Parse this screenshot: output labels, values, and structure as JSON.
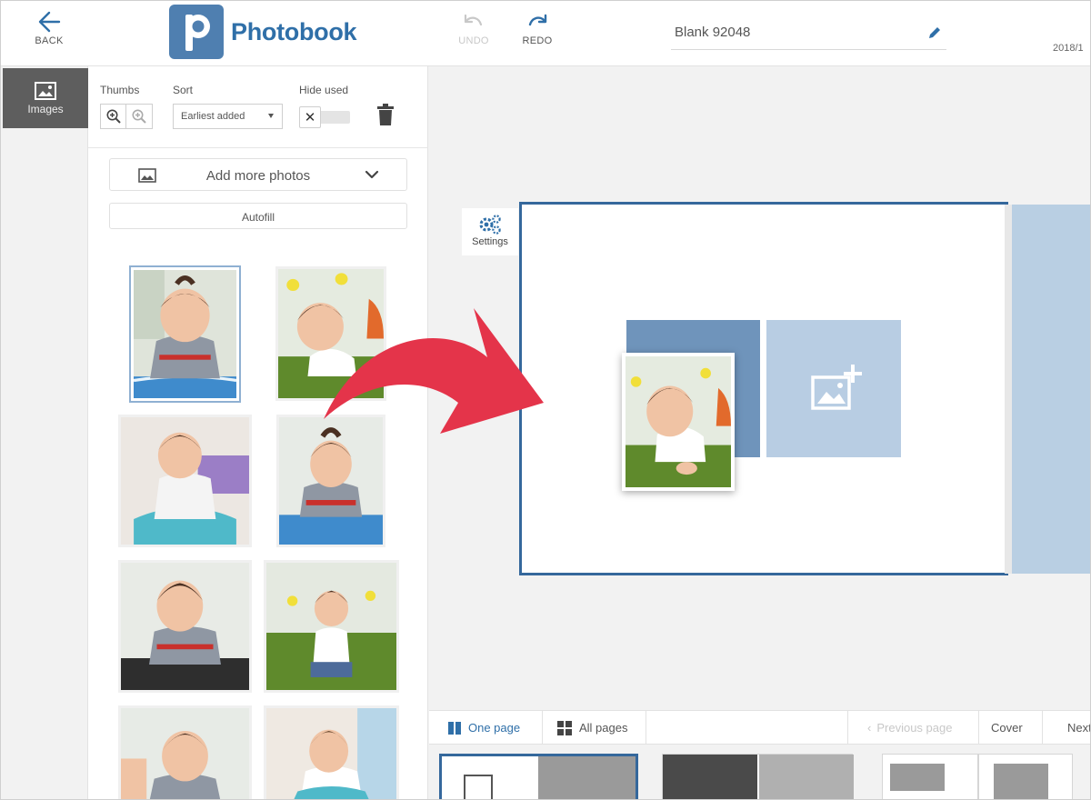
{
  "header": {
    "back_label": "BACK",
    "brand": "Photobook",
    "undo_label": "UNDO",
    "redo_label": "REDO",
    "project_title": "Blank 92048",
    "date_text": "2018/1"
  },
  "rail": {
    "images_label": "Images"
  },
  "panel": {
    "thumbs_label": "Thumbs",
    "sort_label": "Sort",
    "sort_value": "Earliest added",
    "hide_used_label": "Hide used",
    "hide_used_toggle_glyph": "✕",
    "add_more_label": "Add more photos",
    "autofill_label": "Autofill"
  },
  "editor": {
    "settings_label": "Settings"
  },
  "bottom": {
    "one_page_label": "One page",
    "all_pages_label": "All pages",
    "previous_label": "Previous page",
    "cover_label": "Cover",
    "next_label": "Next"
  },
  "colors": {
    "brand_blue": "#2f6fa8",
    "page_border": "#35689c",
    "drag_arrow": "#e4344a",
    "slot_blue": "#b8cde3",
    "rail_active": "#5e5e5e"
  }
}
